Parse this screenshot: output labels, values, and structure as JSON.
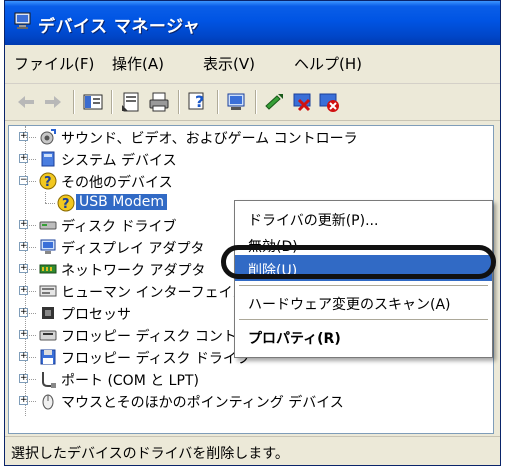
{
  "window": {
    "title": "デバイス マネージャ"
  },
  "menubar": {
    "items": [
      {
        "label": "ファイル(F)"
      },
      {
        "label": "操作(A)"
      },
      {
        "label": "表示(V)"
      },
      {
        "label": "ヘルプ(H)"
      }
    ]
  },
  "tree": {
    "items": [
      {
        "label": "サウンド、ビデオ、およびゲーム コントローラ",
        "icon": "sound-icon"
      },
      {
        "label": "システム デバイス",
        "icon": "system-device-icon"
      },
      {
        "label": "その他のデバイス",
        "icon": "unknown-device-icon"
      },
      {
        "label": "USB Modem",
        "icon": "warning-device-icon"
      },
      {
        "label": "ディスク ドライブ",
        "icon": "disk-drive-icon"
      },
      {
        "label": "ディスプレイ アダプタ",
        "icon": "display-adapter-icon"
      },
      {
        "label": "ネットワーク アダプタ",
        "icon": "network-adapter-icon"
      },
      {
        "label": "ヒューマン インターフェイス デバイス",
        "icon": "hid-icon"
      },
      {
        "label": "プロセッサ",
        "icon": "processor-icon"
      },
      {
        "label": "フロッピー ディスク コントローラ",
        "icon": "floppy-controller-icon"
      },
      {
        "label": "フロッピー ディスク ドライブ",
        "icon": "floppy-drive-icon"
      },
      {
        "label": "ポート (COM と LPT)",
        "icon": "port-icon"
      },
      {
        "label": "マウスとそのほかのポインティング デバイス",
        "icon": "mouse-icon"
      }
    ]
  },
  "context_menu": {
    "items": [
      {
        "label": "ドライバの更新(P)..."
      },
      {
        "label": "無効(D)"
      },
      {
        "label": "削除(U)"
      },
      {
        "label": "ハードウェア変更のスキャン(A)"
      },
      {
        "label": "プロパティ(R)"
      }
    ]
  },
  "statusbar": {
    "text": "選択したデバイスのドライバを削除します。"
  },
  "colors": {
    "title": "#0054e3",
    "selection": "#316ac5"
  }
}
